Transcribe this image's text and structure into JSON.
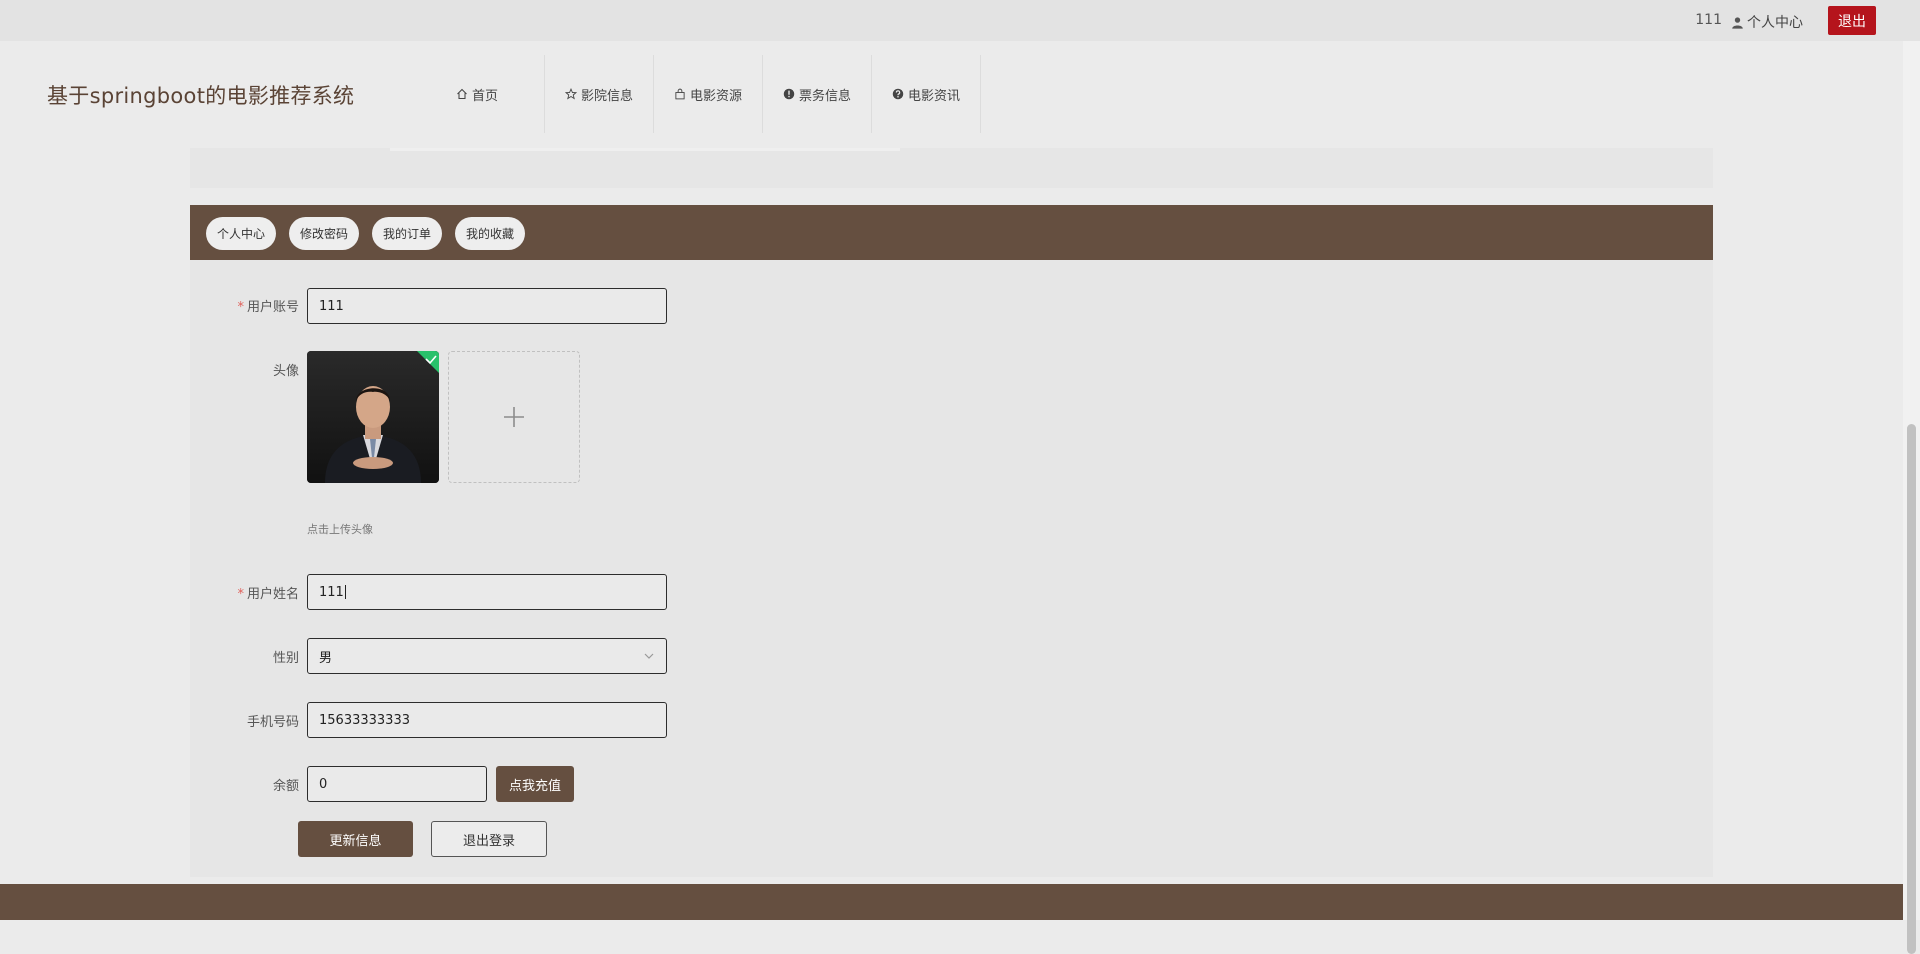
{
  "topbar": {
    "username": "111",
    "center_label": "个人中心",
    "logout_label": "退出"
  },
  "site": {
    "title": "基于springboot的电影推荐系统"
  },
  "nav": {
    "items": [
      {
        "label": "首页",
        "icon": "home-icon"
      },
      {
        "label": "影院信息",
        "icon": "star-icon"
      },
      {
        "label": "电影资源",
        "icon": "bag-icon"
      },
      {
        "label": "票务信息",
        "icon": "info-icon"
      },
      {
        "label": "电影资讯",
        "icon": "question-icon"
      }
    ]
  },
  "tabs": [
    "个人中心",
    "修改密码",
    "我的订单",
    "我的收藏"
  ],
  "form": {
    "account_label": "用户账号",
    "account_value": "111",
    "avatar_label": "头像",
    "avatar_hint": "点击上传头像",
    "name_label": "用户姓名",
    "name_value": "111",
    "gender_label": "性别",
    "gender_value": "男",
    "phone_label": "手机号码",
    "phone_value": "15633333333",
    "balance_label": "余额",
    "balance_value": "0",
    "recharge_label": "点我充值",
    "update_label": "更新信息",
    "logout_label": "退出登录"
  },
  "colors": {
    "brand_brown": "#654f40",
    "logout_red": "#b5141c",
    "upload_success": "#29c16b"
  }
}
